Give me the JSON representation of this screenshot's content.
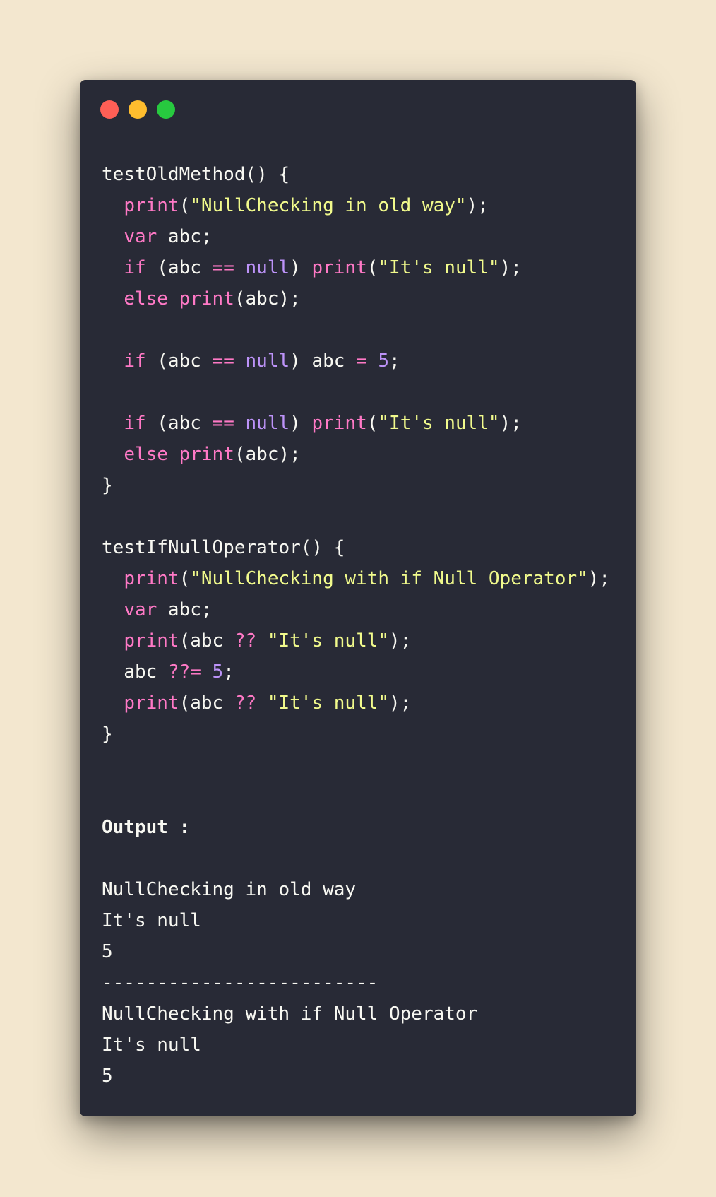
{
  "window": {
    "traffic_lights": [
      {
        "name": "close",
        "color": "#ff5f56"
      },
      {
        "name": "minimize",
        "color": "#ffbd2e"
      },
      {
        "name": "maximize",
        "color": "#27c93f"
      }
    ]
  },
  "code": {
    "lines": [
      [
        {
          "t": "testOldMethod() {",
          "c": "p"
        }
      ],
      [
        {
          "t": "  ",
          "c": "p"
        },
        {
          "t": "print",
          "c": "k"
        },
        {
          "t": "(",
          "c": "p"
        },
        {
          "t": "\"NullChecking in old way\"",
          "c": "s"
        },
        {
          "t": ");",
          "c": "p"
        }
      ],
      [
        {
          "t": "  ",
          "c": "p"
        },
        {
          "t": "var",
          "c": "k"
        },
        {
          "t": " abc;",
          "c": "p"
        }
      ],
      [
        {
          "t": "  ",
          "c": "p"
        },
        {
          "t": "if",
          "c": "k"
        },
        {
          "t": " (abc ",
          "c": "p"
        },
        {
          "t": "==",
          "c": "k"
        },
        {
          "t": " ",
          "c": "p"
        },
        {
          "t": "null",
          "c": "n"
        },
        {
          "t": ") ",
          "c": "p"
        },
        {
          "t": "print",
          "c": "k"
        },
        {
          "t": "(",
          "c": "p"
        },
        {
          "t": "\"It's null\"",
          "c": "s"
        },
        {
          "t": ");",
          "c": "p"
        }
      ],
      [
        {
          "t": "  ",
          "c": "p"
        },
        {
          "t": "else",
          "c": "k"
        },
        {
          "t": " ",
          "c": "p"
        },
        {
          "t": "print",
          "c": "k"
        },
        {
          "t": "(abc);",
          "c": "p"
        }
      ],
      [],
      [
        {
          "t": "  ",
          "c": "p"
        },
        {
          "t": "if",
          "c": "k"
        },
        {
          "t": " (abc ",
          "c": "p"
        },
        {
          "t": "==",
          "c": "k"
        },
        {
          "t": " ",
          "c": "p"
        },
        {
          "t": "null",
          "c": "n"
        },
        {
          "t": ") abc ",
          "c": "p"
        },
        {
          "t": "=",
          "c": "k"
        },
        {
          "t": " ",
          "c": "p"
        },
        {
          "t": "5",
          "c": "n"
        },
        {
          "t": ";",
          "c": "p"
        }
      ],
      [],
      [
        {
          "t": "  ",
          "c": "p"
        },
        {
          "t": "if",
          "c": "k"
        },
        {
          "t": " (abc ",
          "c": "p"
        },
        {
          "t": "==",
          "c": "k"
        },
        {
          "t": " ",
          "c": "p"
        },
        {
          "t": "null",
          "c": "n"
        },
        {
          "t": ") ",
          "c": "p"
        },
        {
          "t": "print",
          "c": "k"
        },
        {
          "t": "(",
          "c": "p"
        },
        {
          "t": "\"It's null\"",
          "c": "s"
        },
        {
          "t": ");",
          "c": "p"
        }
      ],
      [
        {
          "t": "  ",
          "c": "p"
        },
        {
          "t": "else",
          "c": "k"
        },
        {
          "t": " ",
          "c": "p"
        },
        {
          "t": "print",
          "c": "k"
        },
        {
          "t": "(abc);",
          "c": "p"
        }
      ],
      [
        {
          "t": "}",
          "c": "p"
        }
      ],
      [],
      [
        {
          "t": "testIfNullOperator() {",
          "c": "p"
        }
      ],
      [
        {
          "t": "  ",
          "c": "p"
        },
        {
          "t": "print",
          "c": "k"
        },
        {
          "t": "(",
          "c": "p"
        },
        {
          "t": "\"NullChecking with if Null Operator\"",
          "c": "s"
        },
        {
          "t": ");",
          "c": "p"
        }
      ],
      [
        {
          "t": "  ",
          "c": "p"
        },
        {
          "t": "var",
          "c": "k"
        },
        {
          "t": " abc;",
          "c": "p"
        }
      ],
      [
        {
          "t": "  ",
          "c": "p"
        },
        {
          "t": "print",
          "c": "k"
        },
        {
          "t": "(abc ",
          "c": "p"
        },
        {
          "t": "??",
          "c": "k"
        },
        {
          "t": " ",
          "c": "p"
        },
        {
          "t": "\"It's null\"",
          "c": "s"
        },
        {
          "t": ");",
          "c": "p"
        }
      ],
      [
        {
          "t": "  abc ",
          "c": "p"
        },
        {
          "t": "??=",
          "c": "k"
        },
        {
          "t": " ",
          "c": "p"
        },
        {
          "t": "5",
          "c": "n"
        },
        {
          "t": ";",
          "c": "p"
        }
      ],
      [
        {
          "t": "  ",
          "c": "p"
        },
        {
          "t": "print",
          "c": "k"
        },
        {
          "t": "(abc ",
          "c": "p"
        },
        {
          "t": "??",
          "c": "k"
        },
        {
          "t": " ",
          "c": "p"
        },
        {
          "t": "\"It's null\"",
          "c": "s"
        },
        {
          "t": ");",
          "c": "p"
        }
      ],
      [
        {
          "t": "}",
          "c": "p"
        }
      ],
      [],
      [],
      [
        {
          "t": "Output :",
          "c": "b"
        }
      ],
      [],
      [
        {
          "t": "NullChecking in old way",
          "c": "p"
        }
      ],
      [
        {
          "t": "It's null",
          "c": "p"
        }
      ],
      [
        {
          "t": "5",
          "c": "p"
        }
      ],
      [
        {
          "t": "-------------------------",
          "c": "p"
        }
      ],
      [
        {
          "t": "NullChecking with if Null Operator",
          "c": "p"
        }
      ],
      [
        {
          "t": "It's null",
          "c": "p"
        }
      ],
      [
        {
          "t": "5",
          "c": "p"
        }
      ]
    ]
  }
}
